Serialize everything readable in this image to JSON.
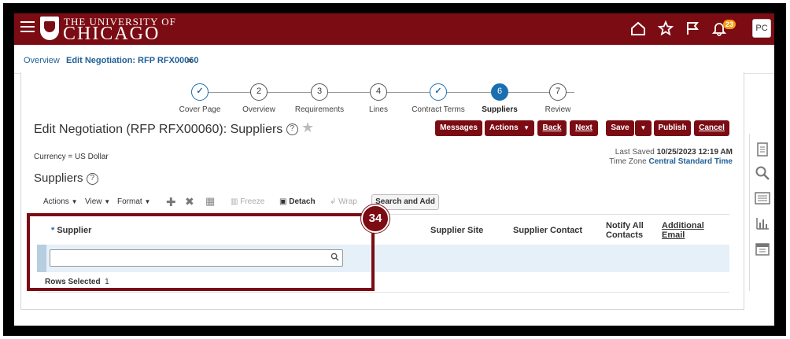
{
  "header": {
    "university_small": "THE UNIVERSITY OF",
    "university_big": "CHICAGO",
    "notification_count": "23",
    "avatar_initials": "PC"
  },
  "tabs": [
    {
      "label": "Overview"
    },
    {
      "label": "Edit Negotiation: RFP RFX00060"
    }
  ],
  "train": {
    "steps": [
      {
        "number": "✓",
        "label": "Cover Page",
        "state": "done"
      },
      {
        "number": "2",
        "label": "Overview",
        "state": "todo"
      },
      {
        "number": "3",
        "label": "Requirements",
        "state": "todo"
      },
      {
        "number": "4",
        "label": "Lines",
        "state": "todo"
      },
      {
        "number": "✓",
        "label": "Contract Terms",
        "state": "done"
      },
      {
        "number": "6",
        "label": "Suppliers",
        "state": "current"
      },
      {
        "number": "7",
        "label": "Review",
        "state": "todo"
      }
    ]
  },
  "page": {
    "title": "Edit Negotiation (RFP RFX00060): Suppliers",
    "help": "?",
    "currency": "Currency = US Dollar",
    "last_saved_label": "Last Saved",
    "last_saved_value": "10/25/2023 12:19 AM",
    "timezone_label": "Time Zone",
    "timezone_value": "Central Standard Time",
    "section_title": "Suppliers"
  },
  "buttons": {
    "messages": "Messages",
    "actions": "Actions",
    "back": "Back",
    "next": "Next",
    "save": "Save",
    "publish": "Publish",
    "cancel": "Cancel"
  },
  "toolbar": {
    "actions": "Actions",
    "view": "View",
    "format": "Format",
    "freeze": "Freeze",
    "detach": "Detach",
    "wrap": "Wrap",
    "search_and_add": "Search and Add"
  },
  "table": {
    "columns": {
      "supplier": "Supplier",
      "supplier_site": "Supplier Site",
      "supplier_contact": "Supplier Contact",
      "notify_line1": "Notify All",
      "notify_line2": "Contacts",
      "additional_line1": "Additional",
      "additional_line2": "Email"
    },
    "required_marker": "*",
    "supplier_value": "",
    "rows_selected_label": "Rows Selected",
    "rows_selected_count": "1"
  },
  "callout": {
    "number": "34"
  },
  "colors": {
    "brand": "#7b0c13",
    "accent": "#1a6fb0",
    "selected_row": "#e6f0f9"
  }
}
